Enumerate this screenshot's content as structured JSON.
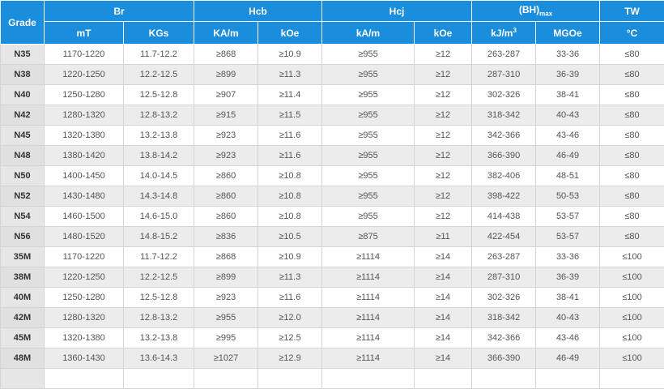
{
  "header": {
    "grade": "Grade",
    "br": "Br",
    "hcb": "Hcb",
    "hcj": "Hcj",
    "bhmax_main": "(BH)",
    "bhmax_sub": "max",
    "tw": "TW",
    "units": [
      "mT",
      "KGs",
      "KA/m",
      "kOe",
      "kA/m",
      "kOe",
      "kJ/m",
      "MGOe",
      "°C"
    ],
    "unit_sup": "3"
  },
  "rows": [
    [
      "N35",
      "1170-1220",
      "11.7-12.2",
      "≥868",
      "≥10.9",
      "≥955",
      "≥12",
      "263-287",
      "33-36",
      "≤80"
    ],
    [
      "N38",
      "1220-1250",
      "12.2-12.5",
      "≥899",
      "≥11.3",
      "≥955",
      "≥12",
      "287-310",
      "36-39",
      "≤80"
    ],
    [
      "N40",
      "1250-1280",
      "12.5-12.8",
      "≥907",
      "≥11.4",
      "≥955",
      "≥12",
      "302-326",
      "38-41",
      "≤80"
    ],
    [
      "N42",
      "1280-1320",
      "12.8-13.2",
      "≥915",
      "≥11.5",
      "≥955",
      "≥12",
      "318-342",
      "40-43",
      "≤80"
    ],
    [
      "N45",
      "1320-1380",
      "13.2-13.8",
      "≥923",
      "≥11.6",
      "≥955",
      "≥12",
      "342-366",
      "43-46",
      "≤80"
    ],
    [
      "N48",
      "1380-1420",
      "13.8-14.2",
      "≥923",
      "≥11.6",
      "≥955",
      "≥12",
      "366-390",
      "46-49",
      "≤80"
    ],
    [
      "N50",
      "1400-1450",
      "14.0-14.5",
      "≥860",
      "≥10.8",
      "≥955",
      "≥12",
      "382-406",
      "48-51",
      "≤80"
    ],
    [
      "N52",
      "1430-1480",
      "14.3-14.8",
      "≥860",
      "≥10.8",
      "≥955",
      "≥12",
      "398-422",
      "50-53",
      "≤80"
    ],
    [
      "N54",
      "1460-1500",
      "14.6-15.0",
      "≥860",
      "≥10.8",
      "≥955",
      "≥12",
      "414-438",
      "53-57",
      "≤80"
    ],
    [
      "N56",
      "1480-1520",
      "14.8-15.2",
      "≥836",
      "≥10.5",
      "≥875",
      "≥11",
      "422-454",
      "53-57",
      "≤80"
    ],
    [
      "35M",
      "1170-1220",
      "11.7-12.2",
      "≥868",
      "≥10.9",
      "≥1114",
      "≥14",
      "263-287",
      "33-36",
      "≤100"
    ],
    [
      "38M",
      "1220-1250",
      "12.2-12.5",
      "≥899",
      "≥11.3",
      "≥1114",
      "≥14",
      "287-310",
      "36-39",
      "≤100"
    ],
    [
      "40M",
      "1250-1280",
      "12.5-12.8",
      "≥923",
      "≥11.6",
      "≥1114",
      "≥14",
      "302-326",
      "38-41",
      "≤100"
    ],
    [
      "42M",
      "1280-1320",
      "12.8-13.2",
      "≥955",
      "≥12.0",
      "≥1114",
      "≥14",
      "318-342",
      "40-43",
      "≤100"
    ],
    [
      "45M",
      "1320-1380",
      "13.2-13.8",
      "≥995",
      "≥12.5",
      "≥1114",
      "≥14",
      "342-366",
      "43-46",
      "≤100"
    ],
    [
      "48M",
      "1360-1430",
      "13.6-14.3",
      "≥1027",
      "≥12.9",
      "≥1114",
      "≥14",
      "366-390",
      "46-49",
      "≤100"
    ],
    [
      "",
      "",
      "",
      "",
      "",
      "",
      "",
      "",
      "",
      ""
    ]
  ],
  "colors": {
    "header_bg": "#1a8ddc",
    "header_text": "#ffffff",
    "grade_bg": "#e6e6e6",
    "row_alt_bg": "#ececec"
  }
}
